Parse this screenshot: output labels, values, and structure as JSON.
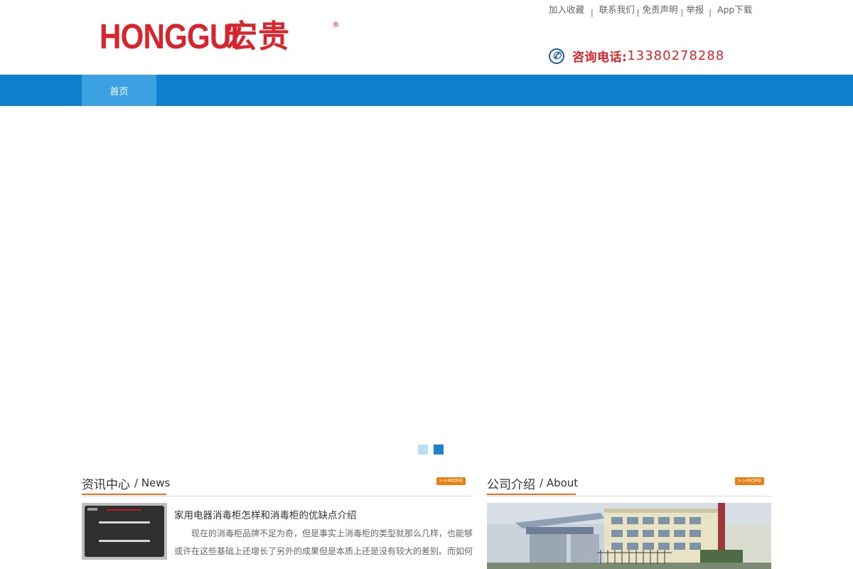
{
  "brand": {
    "logo_latin": "HONGGUI",
    "logo_cn": "宏贵",
    "registered_mark": "®"
  },
  "top_links": [
    {
      "label": "加入收藏"
    },
    {
      "label": "联系我们"
    },
    {
      "label": "免责声明"
    },
    {
      "label": "举报"
    },
    {
      "label": "App下载"
    }
  ],
  "phone": {
    "label": "咨询电话:",
    "number": "13380278288",
    "icon": "phone-icon"
  },
  "nav": {
    "items": [
      {
        "label": "首页",
        "active": true
      }
    ]
  },
  "banner": {
    "slide_count": 2,
    "active_slide": 2
  },
  "news_section": {
    "title_cn": "资讯中心",
    "title_en": "/ News",
    "more_label": ">>MORE",
    "items": [
      {
        "title": "家用电器消毒柜怎样和消毒柜的优缺点介绍",
        "summary": "现在的消毒柜品牌不足为奇，但是事实上消毒柜的类型就那么几样，也能够或许在这些基础上还增长了另外的成果但是本质上还是没有较大的差别。而如何"
      }
    ]
  },
  "about_section": {
    "title_cn": "公司介绍",
    "title_en": "/ About",
    "more_label": ">>MORE"
  },
  "colors": {
    "brand_red": "#d9242b",
    "nav_blue": "#0d80cd",
    "nav_active": "#3ba1e2",
    "accent_orange": "#e2731a"
  }
}
